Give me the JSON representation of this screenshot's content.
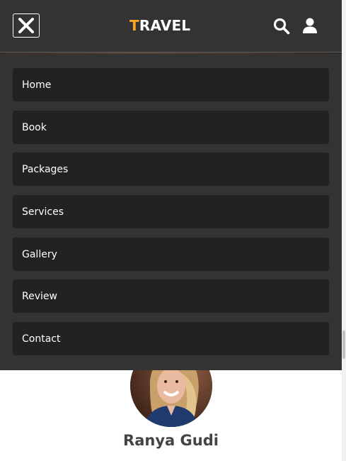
{
  "header": {
    "logo_accent": "T",
    "logo_rest": "RAVEL",
    "accent_color": "#f5a623",
    "background_color": "#333333",
    "icons": [
      "close-icon",
      "search-icon",
      "user-icon"
    ]
  },
  "menu": {
    "items": [
      {
        "label": "Home"
      },
      {
        "label": "Book"
      },
      {
        "label": "Packages"
      },
      {
        "label": "Services"
      },
      {
        "label": "Gallery"
      },
      {
        "label": "Review"
      },
      {
        "label": "Contact"
      }
    ],
    "item_background": "#222222"
  },
  "profile": {
    "name": "Ranya Gudi"
  }
}
